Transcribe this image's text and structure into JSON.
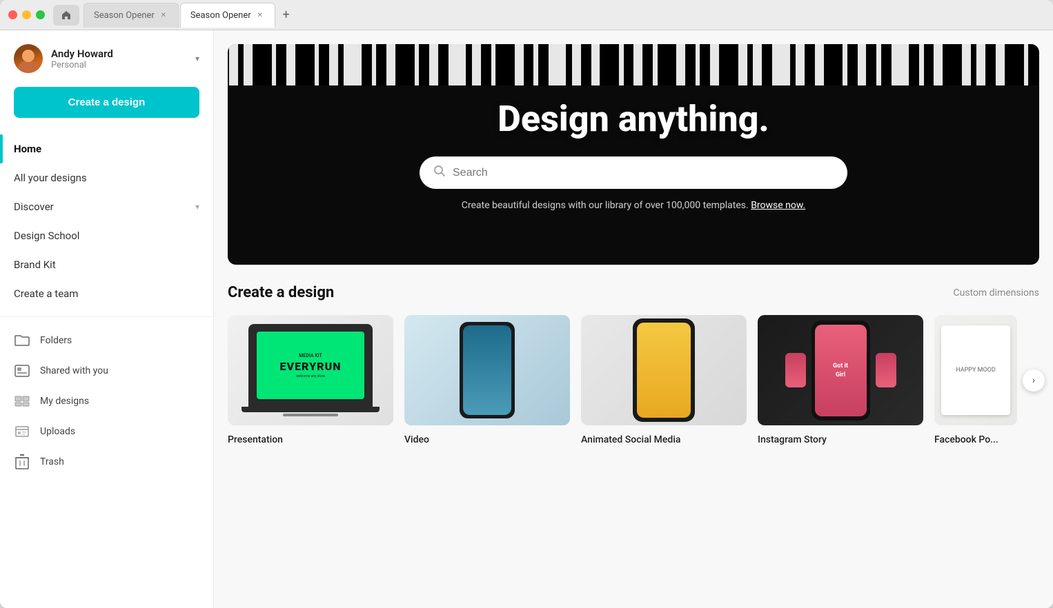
{
  "window": {
    "title": "Season Opener"
  },
  "tabs": [
    {
      "label": "Season Opener",
      "active": false,
      "closable": true
    },
    {
      "label": "Season Opener",
      "active": true,
      "closable": true
    }
  ],
  "sidebar": {
    "user": {
      "name": "Andy Howard",
      "plan": "Personal"
    },
    "create_button": "Create a design",
    "nav": [
      {
        "label": "Home",
        "active": true
      },
      {
        "label": "All your designs",
        "active": false
      },
      {
        "label": "Discover",
        "active": false,
        "hasChevron": true
      },
      {
        "label": "Design School",
        "active": false
      },
      {
        "label": "Brand Kit",
        "active": false
      },
      {
        "label": "Create a team",
        "active": false
      }
    ],
    "sections": [
      {
        "label": "Folders",
        "icon": "folder"
      },
      {
        "label": "Shared with you",
        "icon": "shared"
      },
      {
        "label": "My designs",
        "icon": "my-designs"
      },
      {
        "label": "Uploads",
        "icon": "uploads"
      },
      {
        "label": "Trash",
        "icon": "trash"
      }
    ]
  },
  "hero": {
    "title": "Design anything.",
    "search_placeholder": "Search",
    "subtitle": "Create beautiful designs with our library of over 100,000 templates.",
    "browse_link": "Browse now."
  },
  "create_section": {
    "title": "Create a design",
    "action_label": "Custom dimensions",
    "cards": [
      {
        "label": "Presentation",
        "type": "presentation"
      },
      {
        "label": "Video",
        "type": "video"
      },
      {
        "label": "Animated Social Media",
        "type": "social"
      },
      {
        "label": "Instagram Story",
        "type": "instagram"
      },
      {
        "label": "Facebook Po...",
        "type": "facebook"
      }
    ],
    "carousel_button": "›"
  }
}
